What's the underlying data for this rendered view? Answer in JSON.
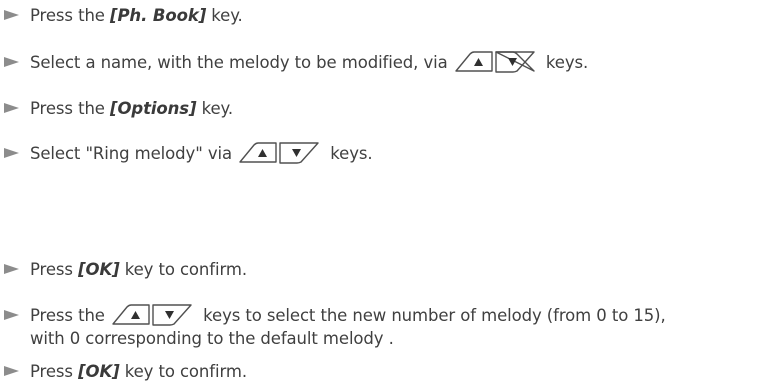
{
  "steps": [
    {
      "id": 1,
      "prefix": "Press the ",
      "key": "[Ph. Book]",
      "suffix": " key."
    },
    {
      "id": 2,
      "prefix": "Select a name, with the melody to be modified, via ",
      "suffix": " keys."
    },
    {
      "id": 3,
      "prefix": "Press the ",
      "key": "[Options]",
      "suffix": " key."
    },
    {
      "id": 4,
      "prefix": "Select \"Ring melody\" via ",
      "suffix": " keys."
    },
    {
      "id": 5,
      "prefix": "Press ",
      "key": "[OK]",
      "suffix": " key to confirm."
    },
    {
      "id": 6,
      "prefix": "Press the ",
      "suffix": " keys to select the new number of melody (from 0 to 15),",
      "line2": "with 0 corresponding to the default melody ."
    },
    {
      "id": 7,
      "prefix": "Press ",
      "key": "[OK]",
      "suffix": " key to confirm."
    }
  ],
  "icons": {
    "bullet": "triangle-bullet-icon",
    "nav_keys": "up-down-navigation-keys-icon"
  },
  "colors": {
    "text": "#404040",
    "bullet": "#8c8c8c",
    "key_outline": "#505050"
  }
}
